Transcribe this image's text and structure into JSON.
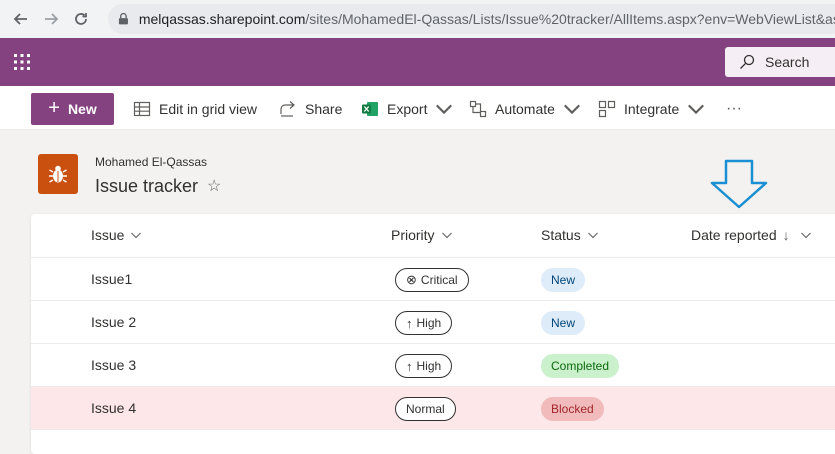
{
  "browser": {
    "url_host": "melqassas.sharepoint.com",
    "url_path": "/sites/MohamedEl-Qassas/Lists/Issue%20tracker/AllItems.aspx?env=WebViewList&as="
  },
  "suitebar": {
    "color": "#854281",
    "search_label": "Search"
  },
  "commandbar": {
    "new_label": "New",
    "edit_grid_label": "Edit in grid view",
    "share_label": "Share",
    "export_label": "Export",
    "automate_label": "Automate",
    "integrate_label": "Integrate",
    "more_label": "···"
  },
  "header": {
    "site_owner": "Mohamed El-Qassas",
    "list_title": "Issue tracker",
    "star": "☆",
    "icon_color": "#ca5010"
  },
  "columns": {
    "issue": "Issue",
    "priority": "Priority",
    "status": "Status",
    "date_reported": "Date reported",
    "sort_arrow": "↓"
  },
  "rows": [
    {
      "issue": "Issue1",
      "priority": "Critical",
      "priority_icon": "⊗",
      "status": "New",
      "status_bg": "#deecf9",
      "status_fg": "#004578",
      "highlight": false
    },
    {
      "issue": "Issue 2",
      "priority": "High",
      "priority_icon": "↑",
      "status": "New",
      "status_bg": "#deecf9",
      "status_fg": "#004578",
      "highlight": false
    },
    {
      "issue": "Issue 3",
      "priority": "High",
      "priority_icon": "↑",
      "status": "Completed",
      "status_bg": "#caf0cc",
      "status_fg": "#0b6a0b",
      "highlight": false
    },
    {
      "issue": "Issue 4",
      "priority": "Normal",
      "priority_icon": "",
      "status": "Blocked",
      "status_bg": "#f1bbbc",
      "status_fg": "#a4262c",
      "highlight": true
    }
  ],
  "annotation": {
    "arrow_color": "#1a8fd1"
  }
}
